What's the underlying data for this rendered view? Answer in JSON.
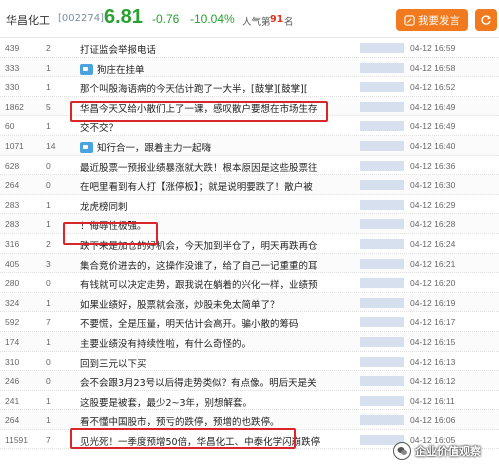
{
  "header": {
    "stock_name": "华昌化工",
    "stock_code": "[002274]",
    "price": "6.81",
    "change": "-0.76",
    "change_pct": "-10.04%",
    "popularity_label": "人气第",
    "popularity_rank": "91",
    "popularity_unit": "名",
    "post_button": "我要发言",
    "colors": {
      "down": "#27a12f",
      "accent": "#f27a1e",
      "highlight": "#d8262b"
    }
  },
  "posts": [
    {
      "reads": "439",
      "replies": "2",
      "title": "打证监会举报电话",
      "tag": false,
      "time": "04-12 16:59"
    },
    {
      "reads": "333",
      "replies": "1",
      "title": "狗庄在挂单",
      "tag": true,
      "time": "04-12 16:58"
    },
    {
      "reads": "330",
      "replies": "1",
      "title": "那个叫殷海语病的今天估计跑了一大半，[鼓掌][鼓掌][",
      "tag": false,
      "time": "04-12 16:52"
    },
    {
      "reads": "1862",
      "replies": "5",
      "title": "华昌今天又给小散们上了一课，感叹散户要想在市场生存",
      "tag": false,
      "time": "04-12 16:49"
    },
    {
      "reads": "60",
      "replies": "1",
      "title": "交不交？",
      "tag": false,
      "time": "04-12 16:49"
    },
    {
      "reads": "1071",
      "replies": "14",
      "title": "知行合一，跟着主力一起嗨",
      "tag": true,
      "time": "04-12 16:40"
    },
    {
      "reads": "628",
      "replies": "0",
      "title": "最近股票一预报业绩暴涨就大跌！根本原因是这些股票往",
      "tag": false,
      "time": "04-12 16:36"
    },
    {
      "reads": "264",
      "replies": "0",
      "title": "在吧里看到有人打【涨停板】；就是说明要跌了！散户被",
      "tag": false,
      "time": "04-12 16:30"
    },
    {
      "reads": "283",
      "replies": "1",
      "title": "龙虎榜同刺",
      "tag": false,
      "time": "04-12 16:29"
    },
    {
      "reads": "283",
      "replies": "1",
      "title": "！侮辱性极强。",
      "tag": false,
      "time": "04-12 16:28"
    },
    {
      "reads": "316",
      "replies": "2",
      "title": "跌下来是加仓的好机会，今天加到半仓了，明天再跌再仓",
      "tag": false,
      "time": "04-12 16:24"
    },
    {
      "reads": "405",
      "replies": "3",
      "title": "集合竞价进去的，这操作没谁了，给了自己一记重重的耳",
      "tag": false,
      "time": "04-12 16:21"
    },
    {
      "reads": "280",
      "replies": "0",
      "title": "有钱就可以决定走势，跟我说在躺着的兴化一样，业绩预",
      "tag": false,
      "time": "04-12 16:20"
    },
    {
      "reads": "324",
      "replies": "1",
      "title": "如果业绩好，股票就会涨，炒股未免太简单了？",
      "tag": false,
      "time": "04-12 16:19"
    },
    {
      "reads": "592",
      "replies": "7",
      "title": "不要慌，全是压量，明天估计会高开。骗小散的筹码",
      "tag": false,
      "time": "04-12 16:17"
    },
    {
      "reads": "174",
      "replies": "1",
      "title": "主要业绩没有持续性啦，有什么奇怪的。",
      "tag": false,
      "time": "04-12 16:15"
    },
    {
      "reads": "310",
      "replies": "0",
      "title": "回到三元以下买",
      "tag": false,
      "time": "04-12 16:13"
    },
    {
      "reads": "246",
      "replies": "0",
      "title": "会不会跟3月23号以后得走势类似？有点像。明后天是关",
      "tag": false,
      "time": "04-12 16:12"
    },
    {
      "reads": "241",
      "replies": "1",
      "title": "这股要是被套，最少2~3年，别想解套。",
      "tag": false,
      "time": "04-12 16:11"
    },
    {
      "reads": "264",
      "replies": "1",
      "title": "看不懂中国股市，预亏的跌停，预增的也跌停。",
      "tag": false,
      "time": "04-12 16:06"
    },
    {
      "reads": "11591",
      "replies": "7",
      "title": "见光死！一季度预增50倍，华昌化工、中泰化学闪崩跌停",
      "tag": false,
      "time": "04-12 16:05"
    }
  ],
  "watermark": {
    "text": "企业价值观察"
  }
}
